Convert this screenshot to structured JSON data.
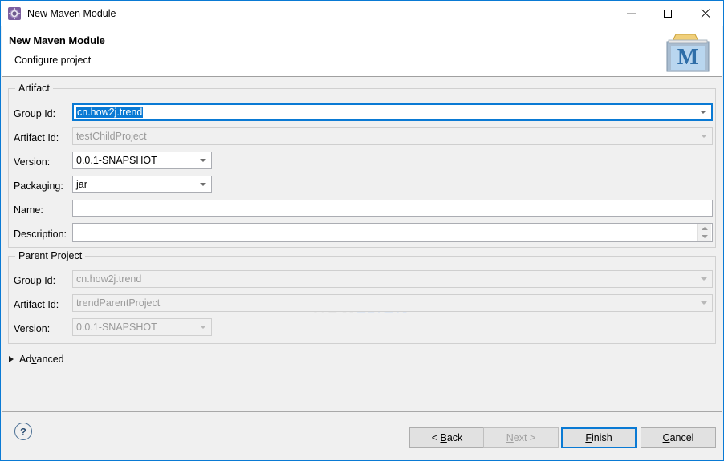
{
  "window": {
    "title": "New Maven Module",
    "icon": "maven-gear-icon",
    "controls": {
      "minimize": "minimize-icon",
      "maximize": "maximize-icon",
      "close": "close-icon"
    },
    "accent_color": "#0a7ad4",
    "background_color": "#f0f0f0"
  },
  "header": {
    "title": "New Maven Module",
    "subtitle": "Configure project",
    "icon": "maven-banner-icon",
    "icon_letter": "M"
  },
  "watermark": {
    "part1": "HOW",
    "part2": "2J.CN"
  },
  "artifact": {
    "legend": "Artifact",
    "fields": [
      {
        "label": "Group Id:",
        "value": "cn.how2j.trend",
        "placeholder": "",
        "type": "combo",
        "state": "focused-selected"
      },
      {
        "label": "Artifact Id:",
        "value": "testChildProject",
        "placeholder": "",
        "type": "combo",
        "state": "disabled"
      },
      {
        "label": "Version:",
        "value": "0.0.1-SNAPSHOT",
        "placeholder": "",
        "type": "combo",
        "state": "enabled"
      },
      {
        "label": "Packaging:",
        "value": "jar",
        "placeholder": "",
        "type": "combo",
        "state": "enabled"
      },
      {
        "label": "Name:",
        "value": "",
        "placeholder": "",
        "type": "combo",
        "state": "enabled"
      },
      {
        "label": "Description:",
        "value": "",
        "placeholder": "",
        "type": "textarea",
        "state": "enabled"
      }
    ]
  },
  "parent_project": {
    "legend": "Parent Project",
    "fields": [
      {
        "label": "Group Id:",
        "value": "cn.how2j.trend",
        "type": "combo",
        "state": "disabled"
      },
      {
        "label": "Artifact Id:",
        "value": "trendParentProject",
        "type": "combo",
        "state": "disabled"
      },
      {
        "label": "Version:",
        "value": "0.0.1-SNAPSHOT",
        "type": "combo",
        "state": "disabled"
      }
    ]
  },
  "advanced": {
    "label_pre": "Ad",
    "label_mnemonic": "v",
    "label_post": "anced",
    "expanded": false
  },
  "footer": {
    "help": "?",
    "buttons": [
      {
        "pre": "< ",
        "mn": "B",
        "post": "ack",
        "state": "enabled"
      },
      {
        "pre": "",
        "mn": "N",
        "post": "ext >",
        "state": "disabled"
      },
      {
        "pre": "",
        "mn": "F",
        "post": "inish",
        "state": "default"
      },
      {
        "pre": "",
        "mn": "C",
        "post": "ancel",
        "state": "enabled"
      }
    ]
  }
}
